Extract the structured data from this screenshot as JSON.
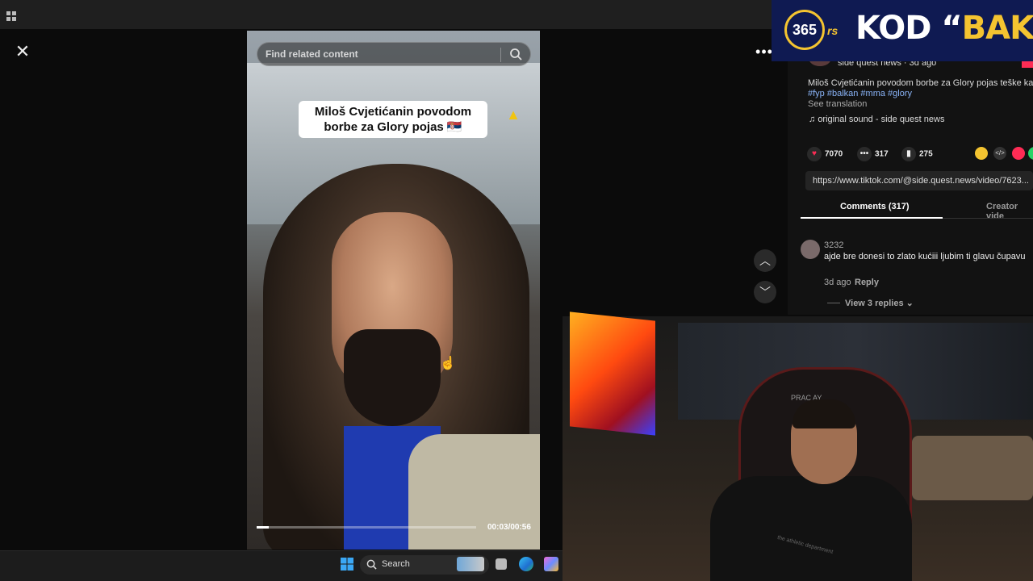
{
  "viewer": {
    "search_placeholder": "Find related content",
    "caption_line1": "Miloš Cvjetićanin povodom",
    "caption_line2": "borbe za Glory pojas 🇷🇸",
    "time": "00:03/00:56",
    "progress": 0.054
  },
  "post": {
    "author": "side quest news · 3d ago",
    "description": "Miloš Cvjetićanin povodom borbe za Glory pojas teške katego",
    "hashtags": "#fyp #balkan #mma #glory",
    "see_translation": "See translation",
    "sound": "original sound - side quest news",
    "likes": "7070",
    "comments": "317",
    "saves": "275",
    "link": "https://www.tiktok.com/@side.quest.news/video/7623...",
    "tabs": [
      "Comments (317)",
      "Creator vide"
    ]
  },
  "comment": {
    "user": "3232",
    "text": "ajde bre donesi to zlato kućiii ljubim ti glavu čupavu",
    "date": "3d ago",
    "reply": "Reply",
    "view_replies": "View 3 replies"
  },
  "overlay": {
    "logo_number": "365",
    "logo_suffix": "rs",
    "title_prefix": "KOD “",
    "title_highlight": "BAKA",
    "title_suffix": "”",
    "chair_brand": "PRAC     AY",
    "shirt_text": "the athletic department"
  },
  "taskbar": {
    "search_label": "Search"
  },
  "colors": {
    "accent_red": "#fe2c55",
    "brand_yellow": "#f4c430",
    "brand_navy": "#0f1a52",
    "link_blue": "#8ab4f8"
  }
}
